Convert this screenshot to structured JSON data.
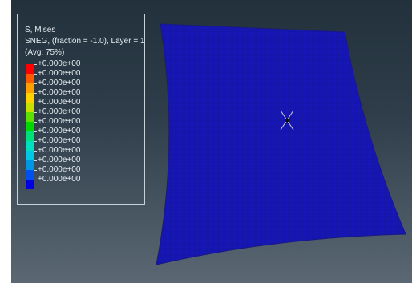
{
  "legend": {
    "title": "S, Mises",
    "subtitle": "SNEG, (fraction = -1.0), Layer = 1",
    "averaging": "(Avg: 75%)",
    "values": [
      "+0.000e+00",
      "+0.000e+00",
      "+0.000e+00",
      "+0.000e+00",
      "+0.000e+00",
      "+0.000e+00",
      "+0.000e+00",
      "+0.000e+00",
      "+0.000e+00",
      "+0.000e+00",
      "+0.000e+00",
      "+0.000e+00",
      "+0.000e+00"
    ],
    "colors": [
      "#ff0000",
      "#ff5a00",
      "#ffa000",
      "#ffd200",
      "#c8e000",
      "#5ee000",
      "#00d800",
      "#00e07a",
      "#00e0c0",
      "#00c8e6",
      "#0096e6",
      "#0050f0",
      "#0000e0"
    ]
  },
  "model": {
    "fill_color": "#1515b8",
    "mesh_color": "#0b0b70",
    "marker": "load-point-marker"
  }
}
